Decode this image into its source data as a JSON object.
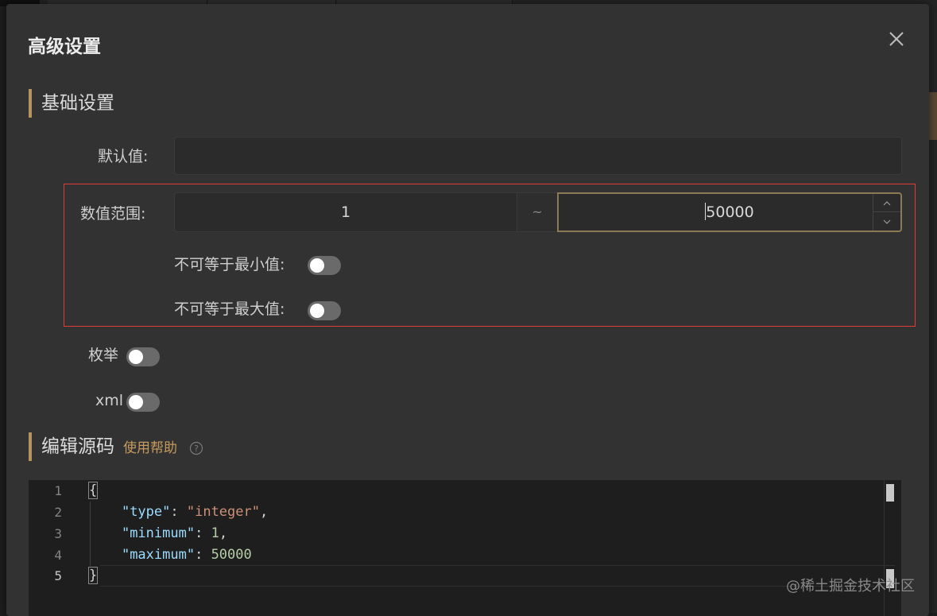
{
  "dialog": {
    "title": "高级设置"
  },
  "basic_section": {
    "title": "基础设置",
    "default_value": {
      "label": "默认值:",
      "value": ""
    },
    "range": {
      "label": "数值范围:",
      "min": "1",
      "separator": "~",
      "max": "50000"
    },
    "exclusive_min": {
      "label": "不可等于最小值:",
      "on": false
    },
    "exclusive_max": {
      "label": "不可等于最大值:",
      "on": false
    },
    "enum": {
      "label": "枚举",
      "on": false
    },
    "xml": {
      "label": "xml",
      "on": false
    }
  },
  "source_section": {
    "title": "编辑源码",
    "help_link": "使用帮助",
    "editor": {
      "line_numbers": [
        "1",
        "2",
        "3",
        "4",
        "5"
      ],
      "lines": [
        {
          "open_brace": "{"
        },
        {
          "key": "\"type\"",
          "colon": ": ",
          "value": "\"integer\"",
          "comma": ","
        },
        {
          "key": "\"minimum\"",
          "colon": ": ",
          "value": "1",
          "comma": ","
        },
        {
          "key": "\"maximum\"",
          "colon": ": ",
          "value": "50000"
        },
        {
          "close_brace": "}"
        }
      ]
    }
  },
  "watermark": "@稀土掘金技术社区",
  "colors": {
    "accent": "#b7935d",
    "highlight_frame": "#e03c3c",
    "help_link": "#c49a5e"
  }
}
